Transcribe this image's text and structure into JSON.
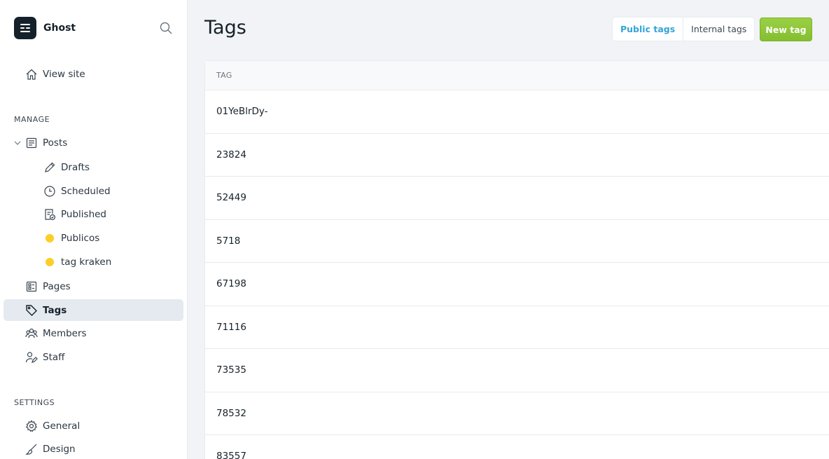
{
  "brand": {
    "name": "Ghost"
  },
  "icons": {
    "search": "search-icon",
    "logo": "ghost-logo-icon"
  },
  "nav": {
    "view_site": "View site",
    "manage_heading": "MANAGE",
    "posts": "Posts",
    "drafts": "Drafts",
    "scheduled": "Scheduled",
    "published": "Published",
    "publicos": "Publicos",
    "tag_kraken": "tag kraken",
    "pages": "Pages",
    "tags": "Tags",
    "members": "Members",
    "staff": "Staff",
    "settings_heading": "SETTINGS",
    "general": "General",
    "design": "Design"
  },
  "colors": {
    "accent": "#34a4d8",
    "primary_button": "#8fc83a",
    "tag_dot": "#fdcd2a"
  },
  "header": {
    "title": "Tags",
    "filter_public": "Public tags",
    "filter_internal": "Internal tags",
    "new_tag": "New tag"
  },
  "table": {
    "column_header": "TAG",
    "rows": [
      "01YeBlrDy-",
      "23824",
      "52449",
      "5718",
      "67198",
      "71116",
      "73535",
      "78532",
      "83557"
    ]
  }
}
